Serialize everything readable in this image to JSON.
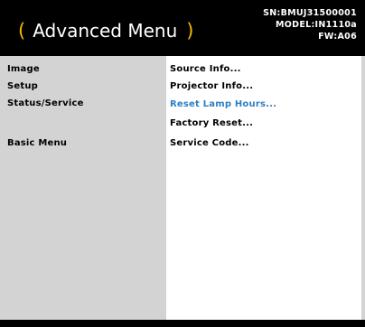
{
  "header": {
    "paren_left": "(",
    "title": "Advanced Menu",
    "paren_right": ")",
    "serial": "SN:BMUJ31500001",
    "model": "MODEL:IN1110a",
    "firmware": "FW:A06"
  },
  "left_menu": {
    "items": [
      {
        "label": "Image"
      },
      {
        "label": "Setup"
      },
      {
        "label": "Status/Service"
      },
      {
        "label": "Basic Menu"
      }
    ]
  },
  "submenu": {
    "items": [
      {
        "label": "Source Info..."
      },
      {
        "label": "Projector Info..."
      },
      {
        "label": "Reset Lamp Hours..."
      },
      {
        "label": "Factory Reset..."
      },
      {
        "label": "Service Code..."
      }
    ],
    "selected_index": 2
  },
  "colors": {
    "header_bg": "#000000",
    "paren_accent": "#f5b800",
    "selected_text": "#2f7fc4",
    "left_panel_bg": "#d3d3d3",
    "right_panel_bg": "#ffffff"
  }
}
